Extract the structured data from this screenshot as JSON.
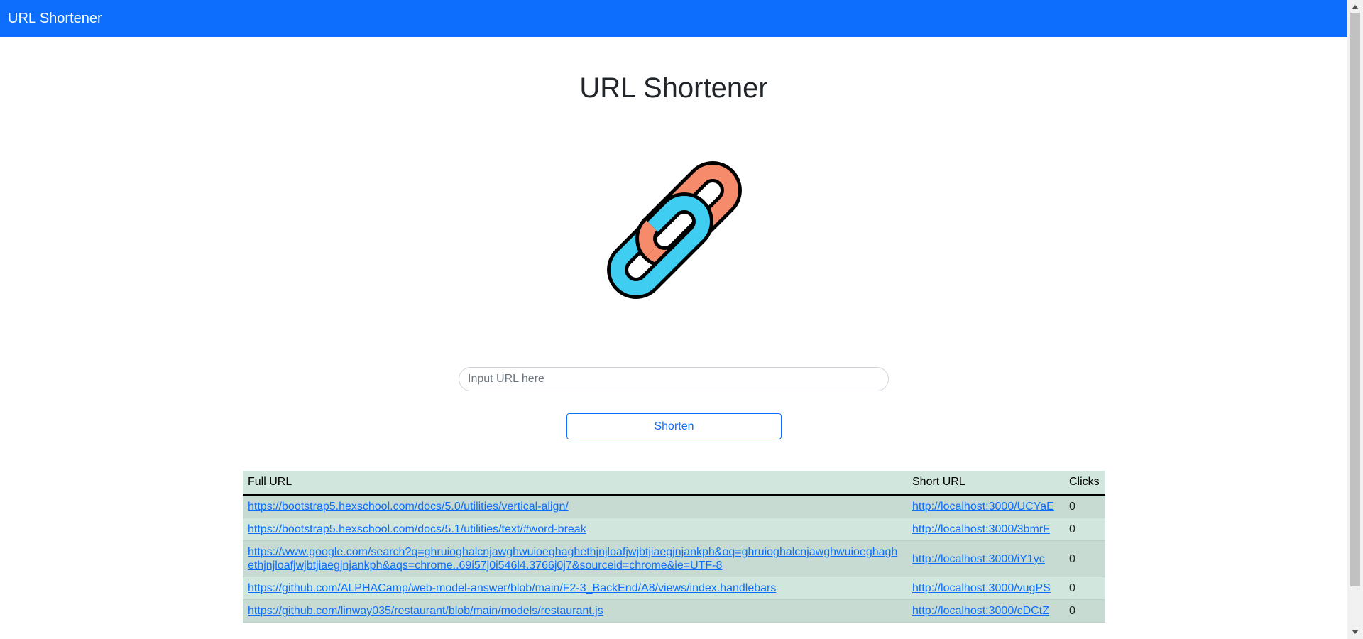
{
  "navbar": {
    "brand": "URL Shortener",
    "color": "#0d6efd"
  },
  "main": {
    "title": "URL Shortener",
    "logo_icon": "chain-link-icon",
    "logo_colors": {
      "left_link": "#3fcdf2",
      "right_link": "#f58b6b",
      "outline": "#000000"
    }
  },
  "form": {
    "input_value": "",
    "input_placeholder": "Input URL here",
    "button_label": "Shorten"
  },
  "table": {
    "headers": [
      "Full URL",
      "Short URL",
      "Clicks"
    ],
    "rows": [
      {
        "full": "https://bootstrap5.hexschool.com/docs/5.0/utilities/vertical-align/",
        "short": "http://localhost:3000/UCYaE",
        "clicks": "0"
      },
      {
        "full": "https://bootstrap5.hexschool.com/docs/5.1/utilities/text/#word-break",
        "short": "http://localhost:3000/3bmrF",
        "clicks": "0"
      },
      {
        "full": "https://www.google.com/search?q=ghruioghalcnjawghwuioeghaghethjnjloafjwjbtjiaegjnjankph&oq=ghruioghalcnjawghwuioeghaghethjnjloafjwjbtjiaegjnjankph&aqs=chrome..69i57j0i546l4.3766j0j7&sourceid=chrome&ie=UTF-8",
        "short": "http://localhost:3000/iY1yc",
        "clicks": "0"
      },
      {
        "full": "https://github.com/ALPHACamp/web-model-answer/blob/main/F2-3_BackEnd/A8/views/index.handlebars",
        "short": "http://localhost:3000/vugPS",
        "clicks": "0"
      },
      {
        "full": "https://github.com/linway035/restaurant/blob/main/models/restaurant.js",
        "short": "http://localhost:3000/cDCtZ",
        "clicks": "0"
      }
    ]
  }
}
